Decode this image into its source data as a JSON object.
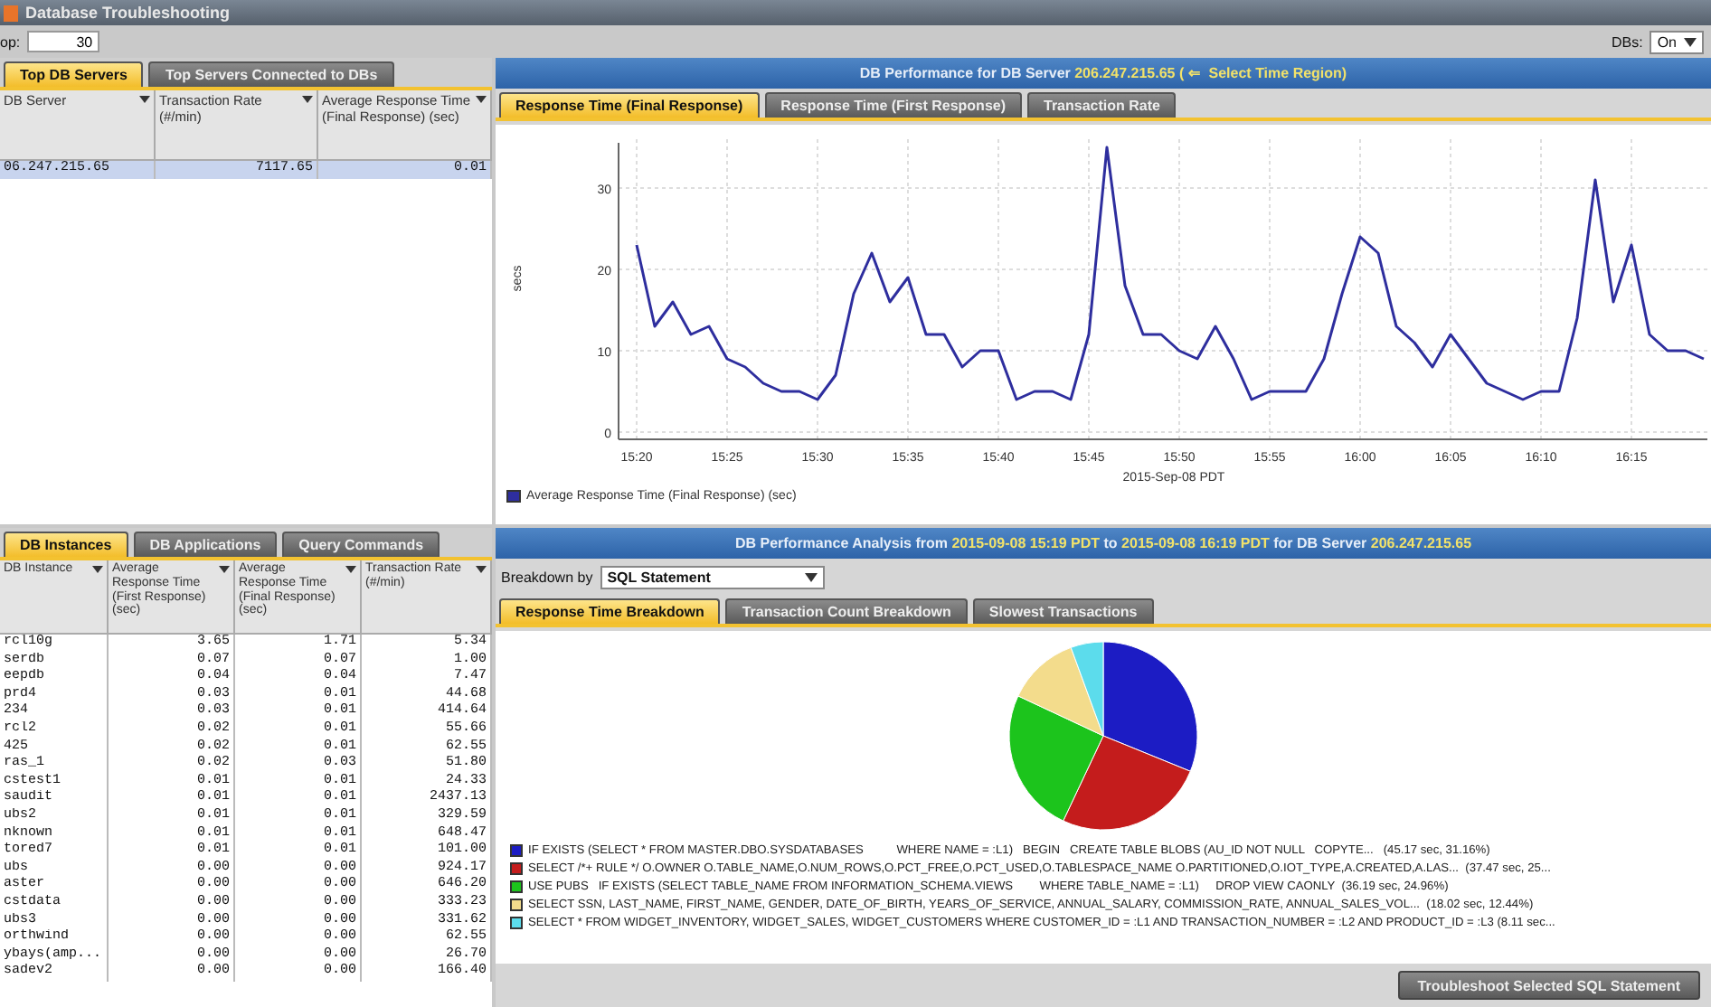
{
  "window": {
    "title": "Database Troubleshooting"
  },
  "toolbar": {
    "top_label": "op:",
    "top_value": "30",
    "dbs_label": "DBs:",
    "dbs_value": "On"
  },
  "servers_panel": {
    "tabs": [
      {
        "label": "Top DB Servers",
        "selected": true
      },
      {
        "label": "Top Servers Connected to DBs",
        "selected": false
      }
    ],
    "columns": [
      "DB Server",
      "Transaction Rate (#/min)",
      "Average Response Time (Final Response) (sec)"
    ],
    "rows": [
      {
        "cells": [
          "06.247.215.65",
          "7117.65",
          "0.01"
        ],
        "selected": true
      }
    ]
  },
  "performance_panel": {
    "header": [
      {
        "text": "DB Performance for DB Server ",
        "highlight": false
      },
      {
        "text": "206.247.215.65 ( ⇐  Select Time Region)",
        "highlight": true
      }
    ],
    "tabs": [
      {
        "label": "Response Time (Final Response)",
        "selected": true
      },
      {
        "label": "Response Time (First Response)",
        "selected": false
      },
      {
        "label": "Transaction Rate",
        "selected": false
      }
    ],
    "chart_data": {
      "type": "line",
      "xlabel": "2015-Sep-08 PDT",
      "ylabel": "secs",
      "grid": true,
      "ylim": [
        0,
        36
      ],
      "yticks": [
        0,
        10,
        20,
        30
      ],
      "categories": [
        "15:20",
        null,
        null,
        null,
        null,
        "15:25",
        null,
        null,
        null,
        null,
        "15:30",
        null,
        null,
        null,
        null,
        "15:35",
        null,
        null,
        null,
        null,
        "15:40",
        null,
        null,
        null,
        null,
        "15:45",
        null,
        null,
        null,
        null,
        "15:50",
        null,
        null,
        null,
        null,
        "15:55",
        null,
        null,
        null,
        null,
        "16:00",
        null,
        null,
        null,
        null,
        "16:05",
        null,
        null,
        null,
        null,
        "16:10",
        null,
        null,
        null,
        null,
        "16:15",
        null,
        null,
        null,
        null
      ],
      "series": [
        {
          "name": "Average Response Time (Final Response) (sec)",
          "color": "#2e2e9e",
          "values": [
            23,
            13,
            16,
            12,
            13,
            9,
            8,
            6,
            5,
            5,
            4,
            7,
            17,
            22,
            16,
            19,
            12,
            12,
            8,
            10,
            10,
            4,
            5,
            5,
            4,
            12,
            35,
            18,
            12,
            12,
            10,
            9,
            13,
            9,
            4,
            5,
            5,
            5,
            9,
            17,
            24,
            22,
            13,
            11,
            8,
            12,
            9,
            6,
            5,
            4,
            5,
            5,
            14,
            31,
            16,
            23,
            12,
            10,
            10,
            9
          ]
        }
      ]
    }
  },
  "instances_panel": {
    "tabs": [
      {
        "label": "DB Instances",
        "selected": true
      },
      {
        "label": "DB Applications",
        "selected": false
      },
      {
        "label": "Query Commands",
        "selected": false
      }
    ],
    "columns": [
      "DB Instance",
      "Average Response Time (First Response) (sec)",
      "Average Response Time (Final Response) (sec)",
      "Transaction Rate (#/min)"
    ],
    "rows": [
      [
        "rcl10g",
        "3.65",
        "1.71",
        "5.34"
      ],
      [
        "serdb",
        "0.07",
        "0.07",
        "1.00"
      ],
      [
        "eepdb",
        "0.04",
        "0.04",
        "7.47"
      ],
      [
        "prd4",
        "0.03",
        "0.01",
        "44.68"
      ],
      [
        "234",
        "0.03",
        "0.01",
        "414.64"
      ],
      [
        "rcl2",
        "0.02",
        "0.01",
        "55.66"
      ],
      [
        "425",
        "0.02",
        "0.01",
        "62.55"
      ],
      [
        "ras_1",
        "0.02",
        "0.03",
        "51.80"
      ],
      [
        "cstest1",
        "0.01",
        "0.01",
        "24.33"
      ],
      [
        "saudit",
        "0.01",
        "0.01",
        "2437.13"
      ],
      [
        "ubs2",
        "0.01",
        "0.01",
        "329.59"
      ],
      [
        "nknown",
        "0.01",
        "0.01",
        "648.47"
      ],
      [
        "tored7",
        "0.01",
        "0.01",
        "101.00"
      ],
      [
        "ubs",
        "0.00",
        "0.00",
        "924.17"
      ],
      [
        "aster",
        "0.00",
        "0.00",
        "646.20"
      ],
      [
        "cstdata",
        "0.00",
        "0.00",
        "333.23"
      ],
      [
        "ubs3",
        "0.00",
        "0.00",
        "331.62"
      ],
      [
        "orthwind",
        "0.00",
        "0.00",
        "62.55"
      ],
      [
        "ybays(amp...",
        "0.00",
        "0.00",
        "26.70"
      ],
      [
        "sadev2",
        "0.00",
        "0.00",
        "166.40"
      ]
    ]
  },
  "analysis_panel": {
    "header": [
      {
        "text": "DB Performance Analysis from ",
        "highlight": false
      },
      {
        "text": "2015-09-08 15:19 PDT",
        "highlight": true
      },
      {
        "text": " to ",
        "highlight": false
      },
      {
        "text": "2015-09-08 16:19 PDT",
        "highlight": true
      },
      {
        "text": " for DB Server ",
        "highlight": false
      },
      {
        "text": "206.247.215.65",
        "highlight": true
      }
    ],
    "breakdown_label": "Breakdown by",
    "breakdown_value": "SQL Statement",
    "tabs": [
      {
        "label": "Response Time Breakdown",
        "selected": true
      },
      {
        "label": "Transaction Count Breakdown",
        "selected": false
      },
      {
        "label": "Slowest Transactions",
        "selected": false
      }
    ],
    "chart_data": {
      "type": "pie",
      "values": [
        31.16,
        25.85,
        24.96,
        12.44,
        5.59
      ]
    },
    "legend": [
      {
        "text": "IF EXISTS (SELECT * FROM MASTER.DBO.SYSDATABASES          WHERE NAME = :L1)   BEGIN   CREATE TABLE BLOBS (AU_ID NOT NULL   COPYTE...   (45.17 sec, 31.16%)",
        "color": "#1c1cc4"
      },
      {
        "text": "SELECT /*+ RULE */ O.OWNER O.TABLE_NAME,O.NUM_ROWS,O.PCT_FREE,O.PCT_USED,O.TABLESPACE_NAME O.PARTITIONED,O.IOT_TYPE,A.CREATED,A.LAS...  (37.47 sec, 25...",
        "color": "#c41c1c"
      },
      {
        "text": "USE PUBS   IF EXISTS (SELECT TABLE_NAME FROM INFORMATION_SCHEMA.VIEWS        WHERE TABLE_NAME = :L1)     DROP VIEW CAONLY  (36.19 sec, 24.96%)",
        "color": "#1cc41c"
      },
      {
        "text": "SELECT SSN, LAST_NAME, FIRST_NAME, GENDER, DATE_OF_BIRTH, YEARS_OF_SERVICE, ANNUAL_SALARY, COMMISSION_RATE, ANNUAL_SALES_VOL...  (18.02 sec, 12.44%)",
        "color": "#f3dc8c"
      },
      {
        "text": "SELECT * FROM WIDGET_INVENTORY, WIDGET_SALES, WIDGET_CUSTOMERS WHERE CUSTOMER_ID = :L1 AND TRANSACTION_NUMBER = :L2 AND PRODUCT_ID = :L3 (8.11 sec...",
        "color": "#5cdcec"
      }
    ],
    "button": "Troubleshoot Selected SQL Statement"
  }
}
